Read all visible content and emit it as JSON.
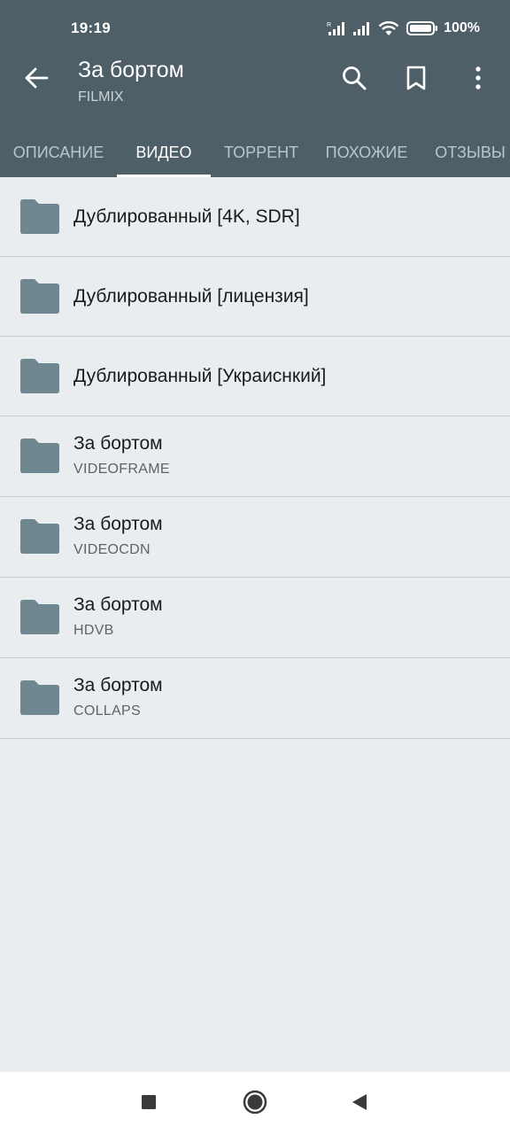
{
  "status_bar": {
    "time": "19:19",
    "battery": "100%",
    "icons": [
      "signal-r-icon",
      "signal-icon",
      "wifi-icon",
      "battery-icon"
    ]
  },
  "app_bar": {
    "title": "За бортом",
    "subtitle": "FILMIX",
    "actions": [
      "back-arrow-icon",
      "search-icon",
      "bookmark-icon",
      "more-vertical-icon"
    ],
    "color": "#4f5f68"
  },
  "tabs": [
    {
      "label": "ОПИСАНИЕ",
      "active": false
    },
    {
      "label": "ВИДЕО",
      "active": true
    },
    {
      "label": "ТОРРЕНТ",
      "active": false
    },
    {
      "label": "ПОХОЖИЕ",
      "active": false
    },
    {
      "label": "ОТЗЫВЫ",
      "active": false
    }
  ],
  "list": [
    {
      "title": "Дублированный [4K, SDR]",
      "subtitle": ""
    },
    {
      "title": "Дублированный [лицензия]",
      "subtitle": ""
    },
    {
      "title": "Дублированный [Украиснкий]",
      "subtitle": ""
    },
    {
      "title": "За бортом",
      "subtitle": "VIDEOFRAME"
    },
    {
      "title": "За бортом",
      "subtitle": "VIDEOCDN"
    },
    {
      "title": "За бортом",
      "subtitle": "HDVB"
    },
    {
      "title": "За бортом",
      "subtitle": "COLLAPS"
    }
  ],
  "folder_color": "#6f8791",
  "nav_bar": {
    "buttons": [
      "recents-square-icon",
      "home-circle-icon",
      "back-triangle-icon"
    ]
  }
}
